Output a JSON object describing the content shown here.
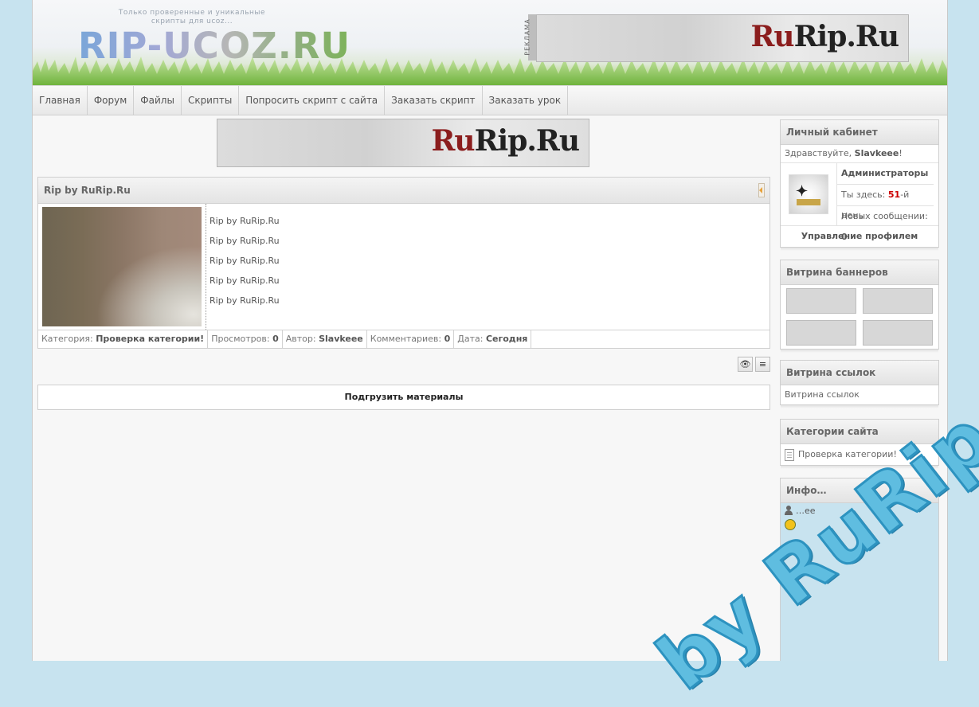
{
  "header": {
    "tagline": "Только проверенные и уникальные скрипты для ucoz...",
    "logo": "RIP-UCOZ.RU",
    "ad_label": "РЕКЛАМА",
    "banner_brand_a": "Ru",
    "banner_brand_b": "Rip.Ru"
  },
  "nav": [
    {
      "label": "Главная"
    },
    {
      "label": "Форум"
    },
    {
      "label": "Файлы"
    },
    {
      "label": "Скрипты"
    },
    {
      "label": "Попросить скрипт с сайта"
    },
    {
      "label": "Заказать скрипт"
    },
    {
      "label": "Заказать урок"
    }
  ],
  "post": {
    "title": "Rip by RuRip.Ru",
    "lines": [
      "Rip by RuRip.Ru",
      "Rip by RuRip.Ru",
      "Rip by RuRip.Ru",
      "Rip by RuRip.Ru",
      "Rip by RuRip.Ru"
    ],
    "meta": {
      "category_label": "Категория:",
      "category_value": "Проверка категории!",
      "views_label": "Просмотров:",
      "views_value": "0",
      "author_label": "Автор:",
      "author_value": "Slavkeee",
      "comments_label": "Комментариев:",
      "comments_value": "0",
      "date_label": "Дата:",
      "date_value": "Сегодня"
    }
  },
  "tools": {
    "view_icon": "eye-icon",
    "list_icon": "list-icon"
  },
  "load_more": "Подгрузить материалы",
  "sidebar": {
    "cabinet": {
      "title": "Личный кабинет",
      "greet_prefix": "Здравствуйте,",
      "username": "Slavkeee",
      "greet_suffix": "!",
      "group": "Администраторы",
      "days_prefix": "Ты здесь:",
      "days_value": "51",
      "days_suffix": "-й день",
      "messages_label": "Новых сообщении:",
      "messages_value": "0",
      "profile_link": "Управление профилем"
    },
    "banners": {
      "title": "Витрина баннеров"
    },
    "links": {
      "title": "Витрина ссылок",
      "text": "Витрина ссылок"
    },
    "categories": {
      "title": "Категории сайта",
      "items": [
        "Проверка категории!"
      ]
    },
    "informer": {
      "title": "Инфо…",
      "user": "…ee"
    }
  },
  "watermark": "by RuRip.Ru",
  "colors": {
    "accent_red": "#cc0000",
    "brand_red": "#8b1d1d",
    "watermark_blue": "#5fbde0",
    "page_bg": "#c7e3ef"
  }
}
